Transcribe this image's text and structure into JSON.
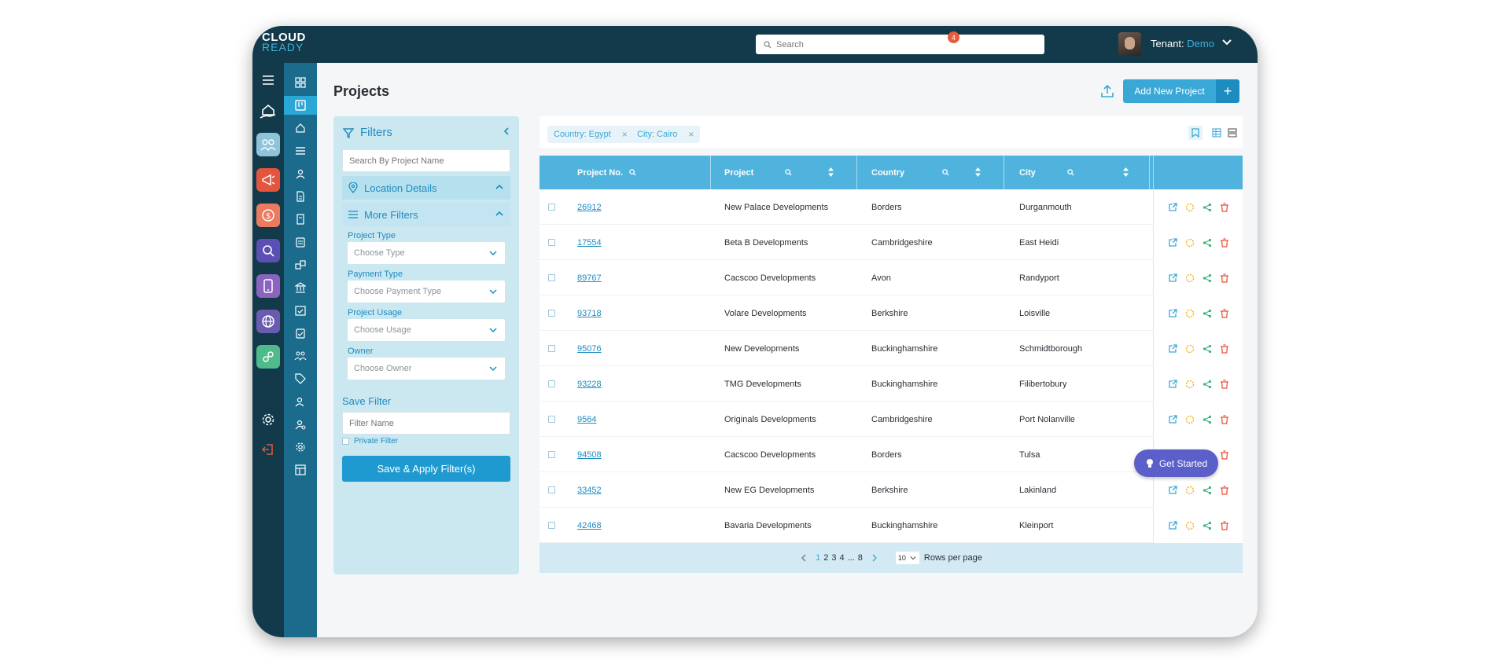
{
  "app": {
    "logo_line1": "CLOUD",
    "logo_line2": "READY"
  },
  "topbar": {
    "search_placeholder": "Search",
    "notifications_count": "4",
    "tenant_label": "Tenant:",
    "tenant_value": "Demo"
  },
  "page": {
    "title": "Projects",
    "add_button": "Add New Project",
    "add_plus": "+"
  },
  "filters": {
    "title": "Filters",
    "search_placeholder": "Search By Project Name",
    "location_section": "Location Details",
    "more_section": "More Filters",
    "fields": [
      {
        "label": "Project Type",
        "placeholder": "Choose Type"
      },
      {
        "label": "Payment Type",
        "placeholder": "Choose Payment Type"
      },
      {
        "label": "Project Usage",
        "placeholder": "Choose  Usage"
      },
      {
        "label": "Owner",
        "placeholder": "Choose Owner"
      }
    ],
    "save_filter_label": "Save Filter",
    "filter_name_placeholder": "Filter Name",
    "private_filter_label": "Private Filter",
    "apply_button": "Save & Apply Filter(s)"
  },
  "chips": [
    {
      "label": "Country: Egypt",
      "remove": "×"
    },
    {
      "label": "City: Cairo",
      "remove": "×"
    }
  ],
  "table": {
    "columns": [
      "Project No.",
      "Project",
      "Country",
      "City"
    ],
    "rows": [
      {
        "no": "26912",
        "project": "New Palace Developments",
        "country": "Borders",
        "city": "Durganmouth"
      },
      {
        "no": "17554",
        "project": "Beta B Developments",
        "country": "Cambridgeshire",
        "city": "East Heidi"
      },
      {
        "no": "89767",
        "project": "Cacscoo Developments",
        "country": "Avon",
        "city": "Randyport"
      },
      {
        "no": "93718",
        "project": "Volare Developments",
        "country": "Berkshire",
        "city": "Loisville"
      },
      {
        "no": "95076",
        "project": "New Developments",
        "country": "Buckinghamshire",
        "city": "Schmidtborough"
      },
      {
        "no": "93228",
        "project": "TMG Developments",
        "country": "Buckinghamshire",
        "city": "Filibertobury"
      },
      {
        "no": "9564",
        "project": "Originals Developments",
        "country": "Cambridgeshire",
        "city": "Port Nolanville"
      },
      {
        "no": "94508",
        "project": "Cacscoo Developments",
        "country": "Borders",
        "city": "Tulsa"
      },
      {
        "no": "33452",
        "project": "New EG Developments",
        "country": "Berkshire",
        "city": "Lakinland"
      },
      {
        "no": "42468",
        "project": "Bavaria Developments",
        "country": "Buckinghamshire",
        "city": "Kleinport"
      }
    ]
  },
  "pagination": {
    "pages": [
      "1",
      "2",
      "3",
      "4",
      "...",
      "8"
    ],
    "current": "1",
    "rows_per_page_value": "10",
    "rows_per_page_label": "Rows per page"
  },
  "get_started": "Get Started",
  "colors": {
    "topbar": "#123a4b",
    "accent": "#3aa8d6",
    "header": "#4fb3dd",
    "delete": "#e8543a",
    "edit": "#f2b632",
    "share": "#3bb37a"
  }
}
